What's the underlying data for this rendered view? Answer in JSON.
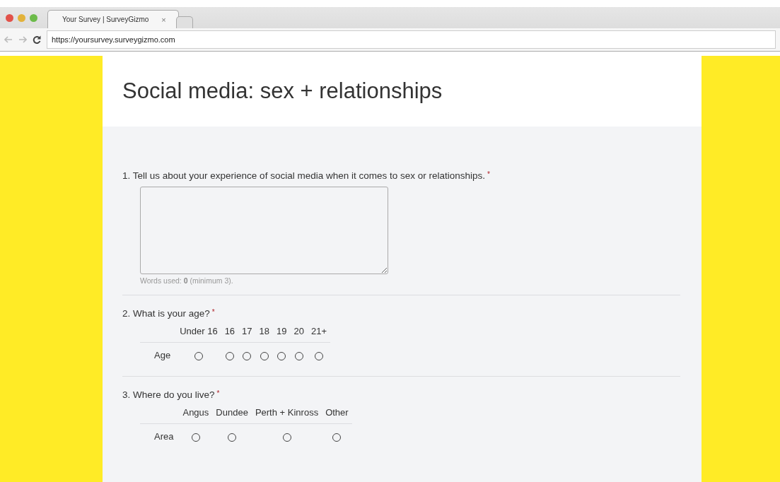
{
  "browser": {
    "tabs": [
      {
        "label": "Your Survey | SurveyGizmo",
        "selected": true,
        "close": "×"
      }
    ],
    "address": "https://yoursurvey.surveygizmo.com"
  },
  "survey": {
    "title": "Social media: sex + relationships",
    "questions": [
      {
        "kind": "essay",
        "number": "1.",
        "text": "Tell us about your experience of social media when it comes to sex or relationships.",
        "required_mark": "*",
        "counter": "Words used: **0** (minimum 3)."
      },
      {
        "kind": "grid",
        "number": "2.",
        "text": "What is your age?",
        "required_mark": "*",
        "columns": [
          "Under 16",
          "16",
          "17",
          "18",
          "19",
          "20",
          "21+"
        ],
        "rows": [
          {
            "label": "Age",
            "options": [
              {
                "selected": false
              },
              {
                "selected": false
              },
              {
                "selected": false
              },
              {
                "selected": false
              },
              {
                "selected": false
              },
              {
                "selected": false
              },
              {
                "selected": false
              }
            ]
          }
        ]
      },
      {
        "kind": "grid",
        "number": "3.",
        "text": "Where do you live?",
        "required_mark": "*",
        "columns": [
          "Angus",
          "Dundee",
          "Perth + Kinross",
          "Other"
        ],
        "rows": [
          {
            "label": "Area",
            "options": [
              {
                "selected": false
              },
              {
                "selected": false
              },
              {
                "selected": false
              },
              {
                "selected": false
              }
            ]
          }
        ]
      }
    ]
  }
}
